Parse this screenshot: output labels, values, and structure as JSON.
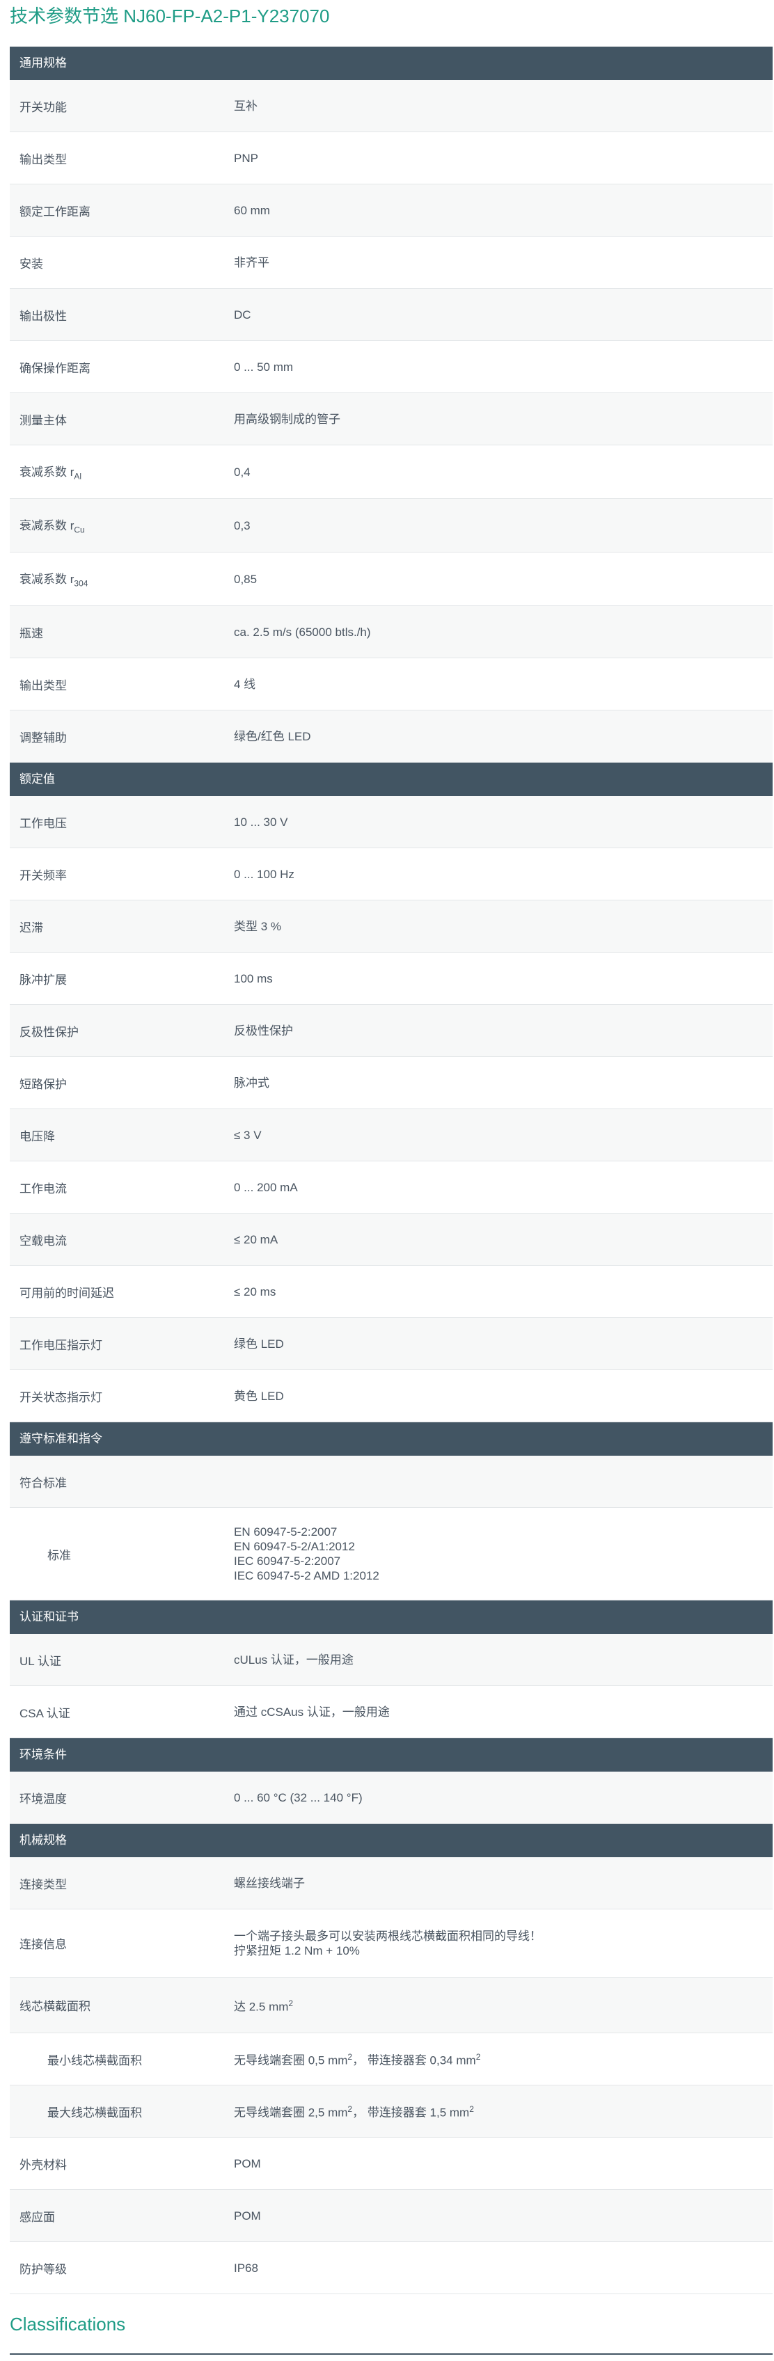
{
  "page": {
    "title": "技术参数节选  NJ60-FP-A2-P1-Y237070",
    "classifications_heading": "Classifications"
  },
  "sections": [
    {
      "title": "通用规格",
      "rows": [
        {
          "label": "开关功能",
          "value": "互补"
        },
        {
          "label": "输出类型",
          "value": "PNP"
        },
        {
          "label": "额定工作距离",
          "value": "60 mm"
        },
        {
          "label": "安装",
          "value": "非齐平"
        },
        {
          "label": "输出极性",
          "value": "DC"
        },
        {
          "label": "确保操作距离",
          "value": "0 ... 50 mm"
        },
        {
          "label": "测量主体",
          "value": "用高级钢制成的管子"
        },
        {
          "label": "衰减系数 r",
          "label_sub": "Al",
          "value": "0,4"
        },
        {
          "label": "衰减系数 r",
          "label_sub": "Cu",
          "value": "0,3"
        },
        {
          "label": "衰减系数 r",
          "label_sub": "304",
          "value": "0,85"
        },
        {
          "label": "瓶速",
          "value": "ca. 2.5 m/s (65000 btls./h)"
        },
        {
          "label": "输出类型",
          "value": "4 线"
        },
        {
          "label": "调整辅助",
          "value": "绿色/红色 LED"
        }
      ]
    },
    {
      "title": "额定值",
      "rows": [
        {
          "label": "工作电压",
          "value": "10 ... 30 V"
        },
        {
          "label": "开关频率",
          "value": "0 ... 100 Hz"
        },
        {
          "label": "迟滞",
          "value": "类型 3 %"
        },
        {
          "label": "脉冲扩展",
          "value": "100 ms"
        },
        {
          "label": "反极性保护",
          "value": "反极性保护"
        },
        {
          "label": "短路保护",
          "value": "脉冲式"
        },
        {
          "label": "电压降",
          "value": "≤ 3 V"
        },
        {
          "label": "工作电流",
          "value": "0 ... 200 mA"
        },
        {
          "label": "空载电流",
          "value": "≤ 20 mA"
        },
        {
          "label": "可用前的时间延迟",
          "value": "≤ 20 ms"
        },
        {
          "label": "工作电压指示灯",
          "value": "绿色 LED"
        },
        {
          "label": "开关状态指示灯",
          "value": "黄色 LED"
        }
      ]
    },
    {
      "title": "遵守标准和指令",
      "rows": [
        {
          "label": "符合标准",
          "value": ""
        },
        {
          "label": "标准",
          "indent": true,
          "lines": [
            "EN 60947-5-2:2007",
            "EN 60947-5-2/A1:2012",
            "IEC 60947-5-2:2007",
            "IEC 60947-5-2 AMD 1:2012"
          ]
        }
      ]
    },
    {
      "title": "认证和证书",
      "rows": [
        {
          "label": "UL 认证",
          "value": "cULus 认证，一般用途"
        },
        {
          "label": "CSA 认证",
          "value": "通过 cCSAus 认证，一般用途"
        }
      ]
    },
    {
      "title": "环境条件",
      "rows": [
        {
          "label": "环境温度",
          "value": "0 ... 60 °C (32 ... 140 °F)"
        }
      ]
    },
    {
      "title": "机械规格",
      "rows": [
        {
          "label": "连接类型",
          "value": "螺丝接线端子"
        },
        {
          "label": "连接信息",
          "lines": [
            "一个端子接头最多可以安装两根线芯横截面积相同的导线！",
            "拧紧扭矩 1.2 Nm + 10%"
          ]
        },
        {
          "label": "线芯横截面积",
          "value": "达 2.5 mm",
          "value_sup": "2"
        },
        {
          "label": "最小线芯横截面积",
          "indent": true,
          "value": "无导线端套圈 0,5 mm",
          "value_sup": "2",
          "value2": "，  带连接器套 0,34 mm",
          "value2_sup": "2"
        },
        {
          "label": "最大线芯横截面积",
          "indent": true,
          "value": "无导线端套圈 2,5 mm",
          "value_sup": "2",
          "value2": "，  带连接器套 1,5 mm",
          "value2_sup": "2"
        },
        {
          "label": "外壳材料",
          "value": "POM"
        },
        {
          "label": "感应面",
          "value": "POM"
        },
        {
          "label": "防护等级",
          "value": "IP68"
        }
      ]
    }
  ]
}
